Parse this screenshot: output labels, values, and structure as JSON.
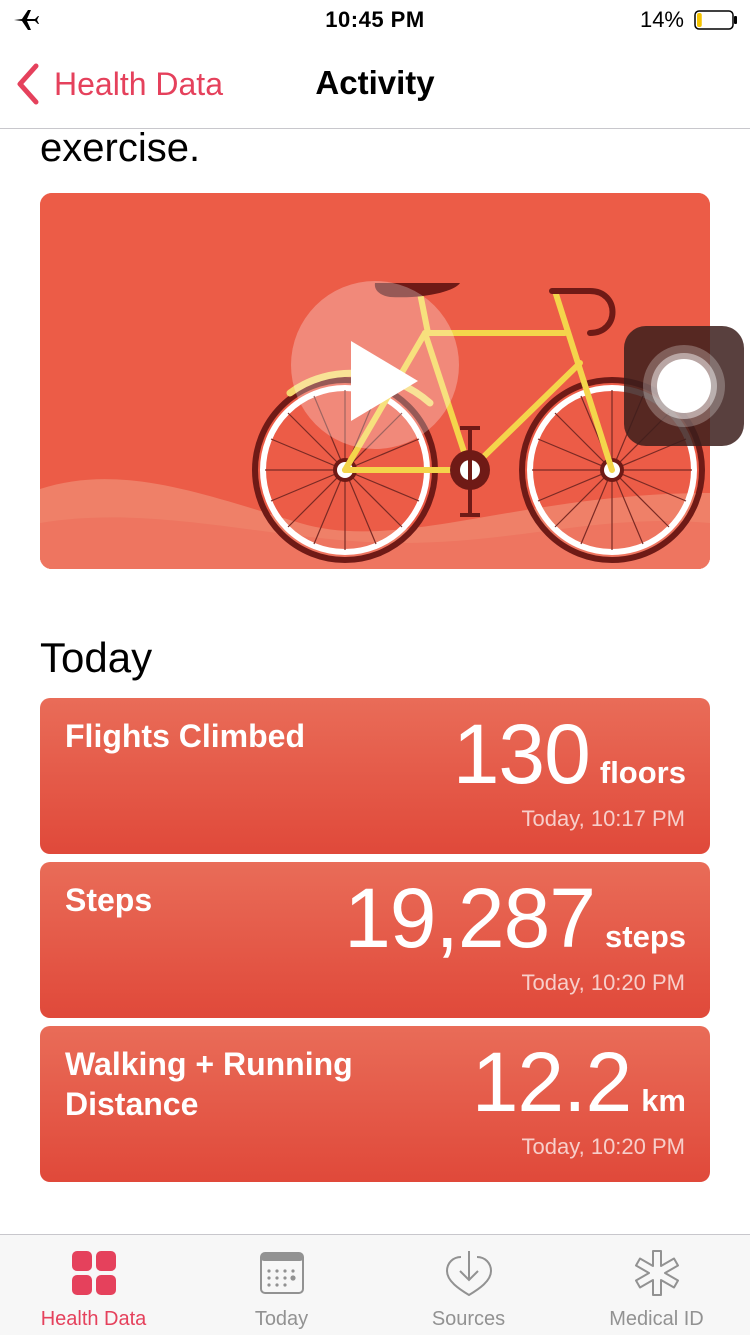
{
  "status_bar": {
    "time": "10:45 PM",
    "battery_percent": "14%",
    "battery_level": 0.14,
    "airplane_icon": "airplane-icon"
  },
  "nav": {
    "back_label": "Health Data",
    "title": "Activity"
  },
  "intro": {
    "text_tail": "exercise."
  },
  "video": {
    "icon": "play-icon",
    "illustration": "bicycle-illustration"
  },
  "today": {
    "section_title": "Today",
    "metrics": [
      {
        "title": "Flights Climbed",
        "value": "130",
        "unit": "floors",
        "time": "Today, 10:17 PM"
      },
      {
        "title": "Steps",
        "value": "19,287",
        "unit": "steps",
        "time": "Today, 10:20 PM"
      },
      {
        "title": "Walking + Running Distance",
        "value": "12.2",
        "unit": "km",
        "time": "Today, 10:20 PM"
      }
    ]
  },
  "tab_bar": {
    "tabs": [
      {
        "label": "Health Data",
        "icon": "grid-icon",
        "active": true
      },
      {
        "label": "Today",
        "icon": "calendar-icon",
        "active": false
      },
      {
        "label": "Sources",
        "icon": "heart-download-icon",
        "active": false
      },
      {
        "label": "Medical ID",
        "icon": "asterisk-icon",
        "active": false
      }
    ]
  },
  "colors": {
    "accent": "#e5415c",
    "card_top": "#e96c58",
    "card_bottom": "#e0493a",
    "video_bg": "#ec5c47"
  }
}
